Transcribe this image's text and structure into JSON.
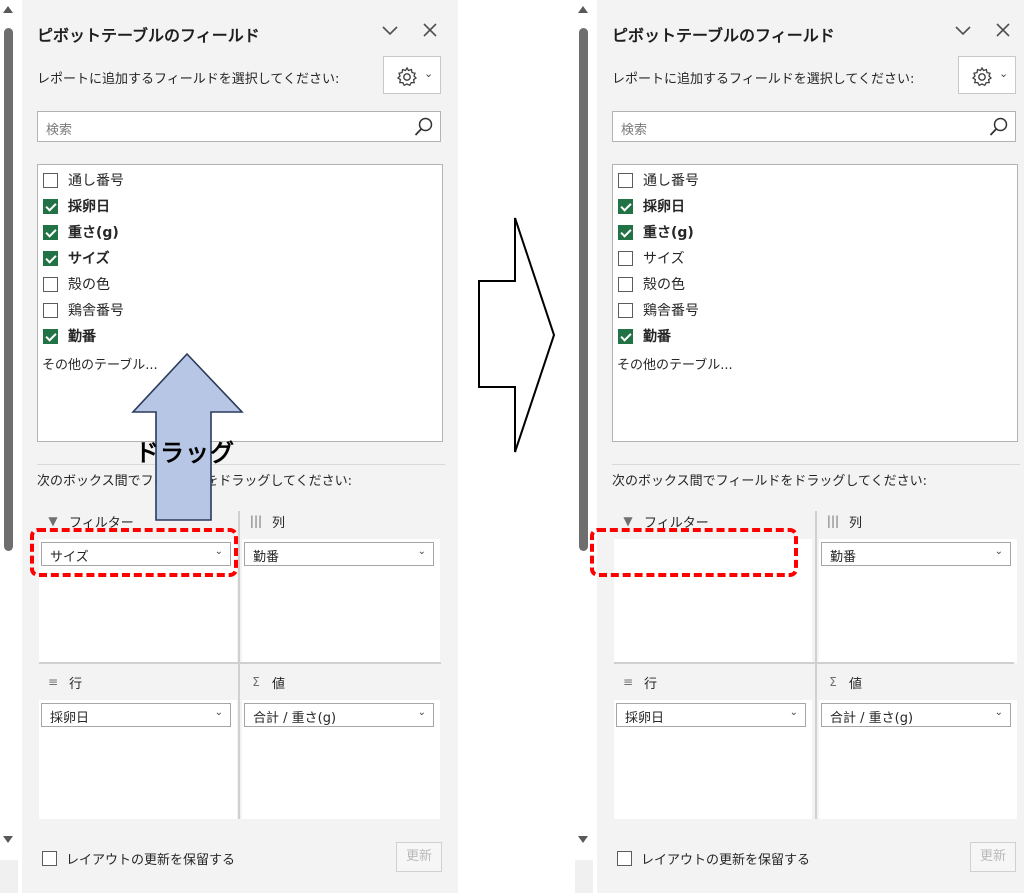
{
  "colors": {
    "accent_check": "#217346",
    "highlight": "#ff0000",
    "drag_arrow": "#b7c6e4"
  },
  "left": {
    "panel_title": "ピボットテーブルのフィールド",
    "subtitle": "レポートに追加するフィールドを選択してください:",
    "search_placeholder": "検索",
    "fields": [
      {
        "label": "通し番号",
        "checked": false
      },
      {
        "label": "採卵日",
        "checked": true
      },
      {
        "label": "重さ(g)",
        "checked": true
      },
      {
        "label": "サイズ",
        "checked": true
      },
      {
        "label": "殻の色",
        "checked": false
      },
      {
        "label": "鶏舎番号",
        "checked": false
      },
      {
        "label": "勤番",
        "checked": true
      }
    ],
    "more_tables": "その他のテーブル...",
    "drag_hint": "次のボックス間でフィールドをドラッグしてください:",
    "areas": {
      "filter": {
        "label": "フィルター",
        "item": "サイズ"
      },
      "columns": {
        "label": "列",
        "item": "勤番"
      },
      "rows": {
        "label": "行",
        "item": "採卵日"
      },
      "values": {
        "label": "値",
        "item": "合計 / 重さ(g)"
      }
    },
    "defer_label": "レイアウトの更新を保留する",
    "update_label": "更新",
    "drag_annotation": "ドラッグ"
  },
  "right": {
    "panel_title": "ピボットテーブルのフィールド",
    "subtitle": "レポートに追加するフィールドを選択してください:",
    "search_placeholder": "検索",
    "fields": [
      {
        "label": "通し番号",
        "checked": false
      },
      {
        "label": "採卵日",
        "checked": true
      },
      {
        "label": "重さ(g)",
        "checked": true
      },
      {
        "label": "サイズ",
        "checked": false
      },
      {
        "label": "殻の色",
        "checked": false
      },
      {
        "label": "鶏舎番号",
        "checked": false
      },
      {
        "label": "勤番",
        "checked": true
      }
    ],
    "more_tables": "その他のテーブル...",
    "drag_hint": "次のボックス間でフィールドをドラッグしてください:",
    "areas": {
      "filter": {
        "label": "フィルター",
        "item": ""
      },
      "columns": {
        "label": "列",
        "item": "勤番"
      },
      "rows": {
        "label": "行",
        "item": "採卵日"
      },
      "values": {
        "label": "値",
        "item": "合計 / 重さ(g)"
      }
    },
    "defer_label": "レイアウトの更新を保留する",
    "update_label": "更新"
  }
}
